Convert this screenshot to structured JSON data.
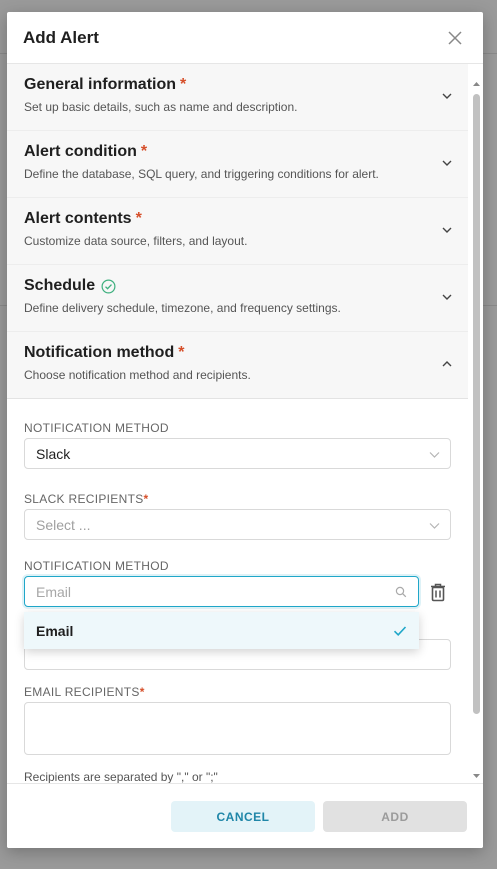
{
  "modal": {
    "title": "Add Alert"
  },
  "sections": [
    {
      "title": "General information",
      "required_mark": "*",
      "description": "Set up basic details, such as name and description."
    },
    {
      "title": "Alert condition",
      "required_mark": "*",
      "description": "Define the database, SQL query, and triggering conditions for alert."
    },
    {
      "title": "Alert contents",
      "required_mark": "*",
      "description": "Customize data source, filters, and layout."
    },
    {
      "title": "Schedule",
      "description": "Define delivery schedule, timezone, and frequency settings."
    },
    {
      "title": "Notification method",
      "required_mark": "*",
      "description": "Choose notification method and recipients."
    }
  ],
  "notification": {
    "method1_label": "NOTIFICATION METHOD",
    "method1_value": "Slack",
    "slack_recipients_label": "SLACK RECIPIENTS",
    "slack_recipients_required": "*",
    "slack_recipients_placeholder": "Select ...",
    "method2_label": "NOTIFICATION METHOD",
    "method2_placeholder": "Email",
    "dropdown_option": "Email",
    "email_recipients_label": "EMAIL RECIPIENTS",
    "email_recipients_required": "*",
    "hint": "Recipients are separated by \",\" or \";\""
  },
  "footer": {
    "cancel_label": "CANCEL",
    "add_label": "ADD"
  },
  "colors": {
    "accent": "#20a7c9",
    "required": "#d64f2a",
    "success": "#3fb07f"
  }
}
